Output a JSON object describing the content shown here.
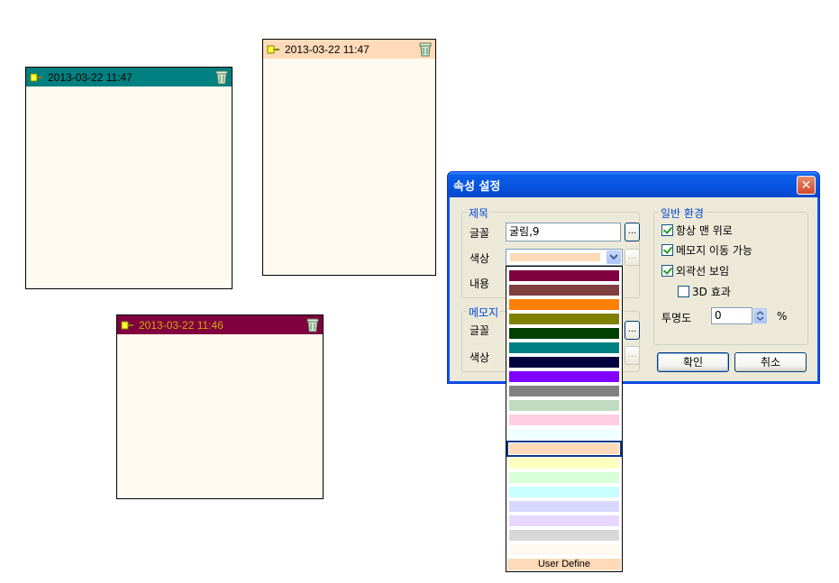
{
  "memos": [
    {
      "time": "2013-03-22 11:47",
      "header_color": "#008080",
      "pin_icon": "pin-icon",
      "trash_icon": "trash-icon"
    },
    {
      "time": "2013-03-22 11:47",
      "header_color": "#ffdab9",
      "pin_icon": "pin-icon",
      "trash_icon": "trash-icon"
    },
    {
      "time": "2013-03-22 11:46",
      "header_color": "#800040",
      "pin_icon": "pin-icon",
      "trash_icon": "trash-icon"
    }
  ],
  "dialog": {
    "title": "속성 설정",
    "close_icon": "close-icon",
    "title_group": {
      "legend": "제목",
      "font_label": "글꼴",
      "font_value": "굴림,9",
      "browse_label": "...",
      "color_label": "색상",
      "content_label": "내용",
      "selected_color": "#ffdab9"
    },
    "memo_group": {
      "legend": "메모지",
      "font_label": "글꼴",
      "color_label": "색상",
      "browse_label": "..."
    },
    "general_group": {
      "legend": "일반 환경",
      "always_on_top": {
        "label": "항상 맨 위로",
        "checked": true
      },
      "movable": {
        "label": "메모지 이동 가능",
        "checked": true
      },
      "show_border": {
        "label": "외곽선 보임",
        "checked": true
      },
      "effect_3d": {
        "label": "3D 효과",
        "checked": false
      },
      "transparency_label": "투명도",
      "transparency_value": "0",
      "percent": "%"
    },
    "ok_label": "확인",
    "cancel_label": "취소"
  },
  "color_list": {
    "colors": [
      "#800040",
      "#804040",
      "#ff8000",
      "#808000",
      "#004000",
      "#008080",
      "#000040",
      "#8000ff",
      "#808080",
      "#c0dcc0",
      "#ffcce0",
      "#f0ffff",
      "#ffdab9",
      "#ffffc0",
      "#d8ffd8",
      "#c8ffff",
      "#d8d8ff",
      "#e8d8ff",
      "#d8d8d8",
      "#fffaf0"
    ],
    "selected_index": 12,
    "user_define": "User Define"
  }
}
